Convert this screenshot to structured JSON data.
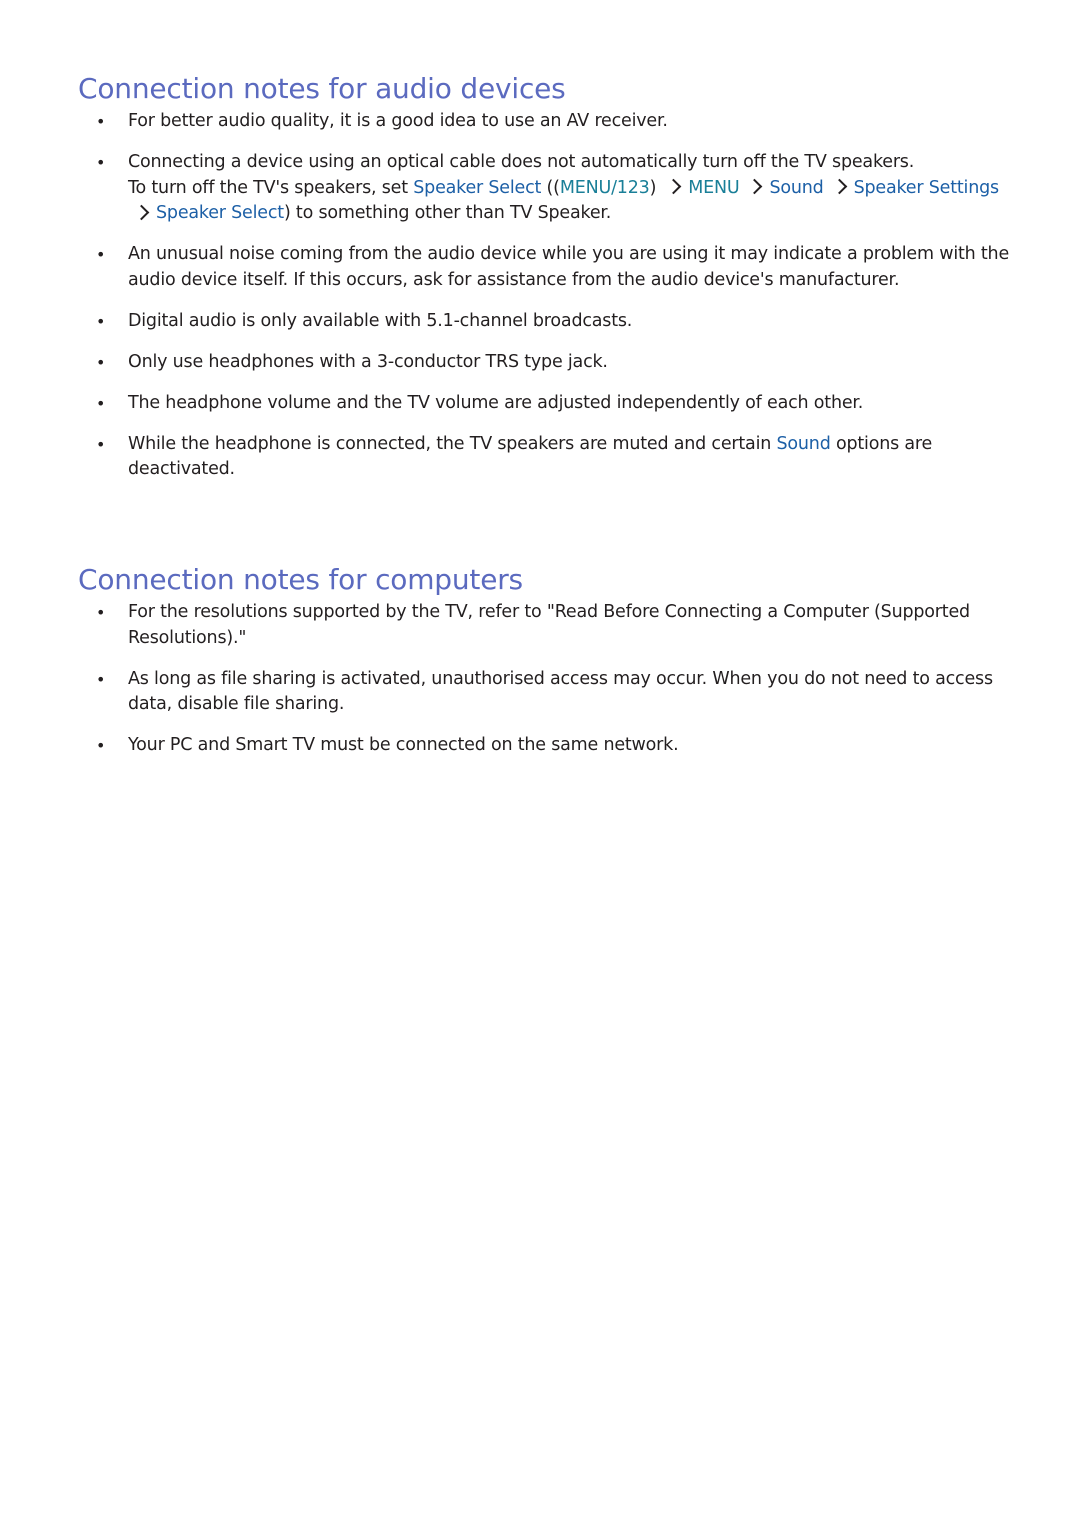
{
  "audio": {
    "title": "Connection notes for audio devices",
    "items": [
      "For better audio quality, it is a good idea to use an AV receiver.",
      {
        "line1": "Connecting a device using an optical cable does not automatically turn off the TV speakers.",
        "pre": "To turn off the TV's speakers, set ",
        "link_speaker_select": "Speaker Select",
        "open_paren": " ((",
        "link_menu123": "MENU/123",
        "close_paren": ")",
        "link_menu": "MENU",
        "link_sound": "Sound",
        "link_speaker_settings": "Speaker Settings",
        "link_speaker_select2": "Speaker Select",
        "post": ") to something other than TV Speaker."
      },
      "An unusual noise coming from the audio device while you are using it may indicate a problem with the audio device itself. If this occurs, ask for assistance from the audio device's manufacturer.",
      "Digital audio is only available with 5.1-channel broadcasts.",
      "Only use headphones with a 3-conductor TRS type jack.",
      "The headphone volume and the TV volume are adjusted independently of each other.",
      {
        "pre": "While the headphone is connected, the TV speakers are muted and certain ",
        "link_sound": "Sound",
        "post": " options are deactivated."
      }
    ]
  },
  "computers": {
    "title": "Connection notes for computers",
    "items": [
      "For the resolutions supported by the TV, refer to \"Read Before Connecting a Computer (Supported Resolutions).\"",
      "As long as file sharing is activated, unauthorised access may occur. When you do not need to access data, disable file sharing.",
      "Your PC and Smart TV must be connected on the same network."
    ]
  }
}
